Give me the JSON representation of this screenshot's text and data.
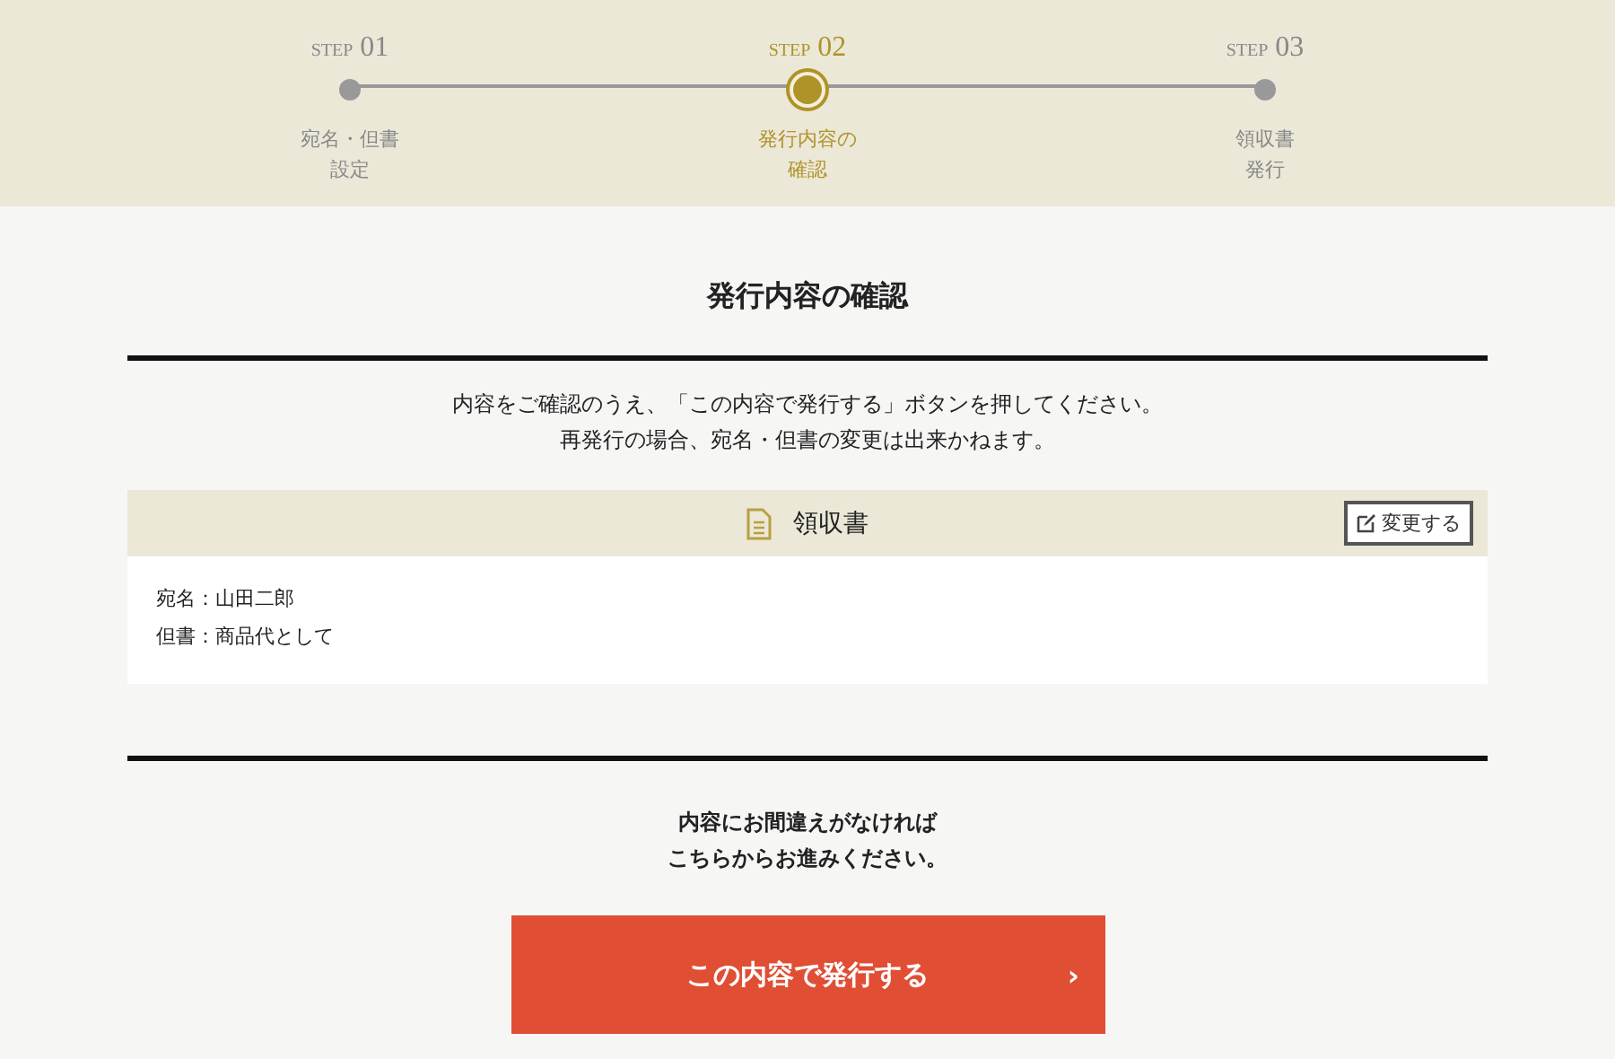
{
  "steps": [
    {
      "step_label": "STEP",
      "number": "01",
      "lines": [
        "宛名・但書",
        "設定"
      ],
      "selected": false
    },
    {
      "step_label": "STEP",
      "number": "02",
      "lines": [
        "発行内容の",
        "確認"
      ],
      "selected": true
    },
    {
      "step_label": "STEP",
      "number": "03",
      "lines": [
        "領収書",
        "発行"
      ],
      "selected": false
    }
  ],
  "title": "発行内容の確認",
  "intro": [
    "内容をご確認のうえ、「この内容で発行する」ボタンを押してください。",
    "再発行の場合、宛名・但書の変更は出来かねます。"
  ],
  "receipt": {
    "title": "領収書",
    "edit_button": "変更する",
    "fields": [
      "宛名：山田二郎",
      "但書：商品代として"
    ]
  },
  "confirm_note": [
    "内容にお間違えがなければ",
    "こちらからお進みください。"
  ],
  "submit": {
    "label": "この内容で発行する",
    "chevron": "›"
  }
}
